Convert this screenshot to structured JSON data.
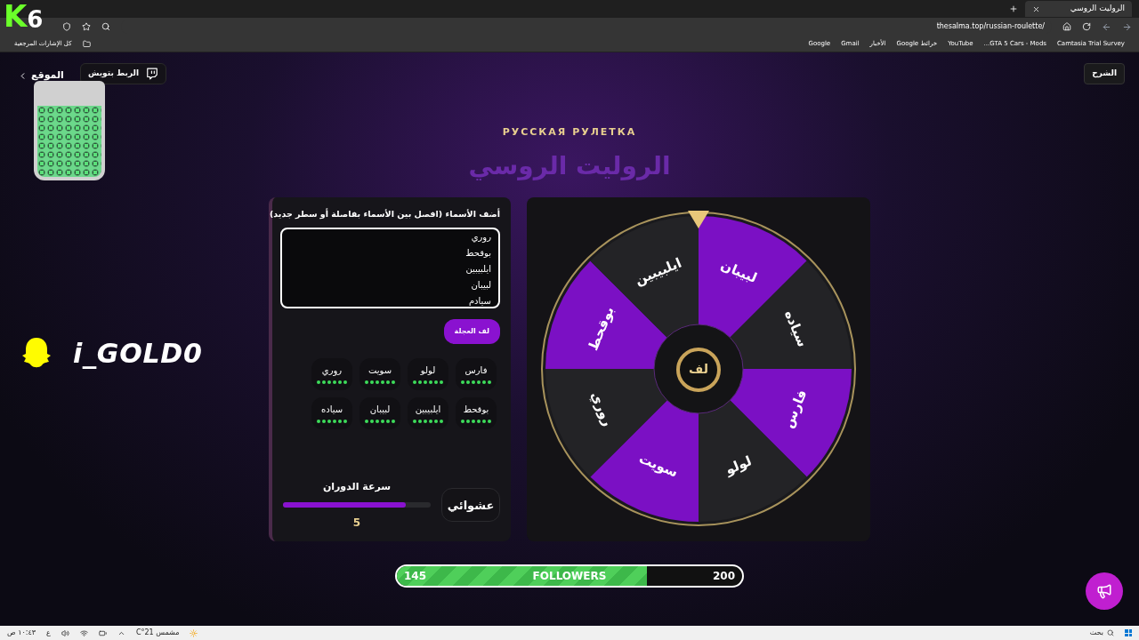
{
  "browser": {
    "tab_title": "الروليت الروسي",
    "url": "thesalma.top/russian-roulette/",
    "bookmarks": [
      "Camtasia Trial Survey",
      "GTA 5 Cars - Mods...",
      "YouTube",
      "خرائط Google",
      "الأخبار",
      "Gmail",
      "Google"
    ],
    "all_bookmarks": "كل الإشارات المرجعية"
  },
  "overlay": {
    "logo_letter": "K",
    "logo_number": "6",
    "snapchat_user": "i_GOLD0"
  },
  "header": {
    "back_link": "الموقع",
    "twitch_button": "الربط بتويش",
    "help_button": "الشرح"
  },
  "subtitle": "РУССКАЯ РУЛЕТКА",
  "title": "الروليت الروسي",
  "names_panel": {
    "label": "أضف الأسماء (افصل بين الأسماء بفاصلة أو سطر جديد)",
    "value": "روري\nبوقحط\nايلبيبين\nلبيبان\nسيادم",
    "spin_button": "لف العجلة",
    "chips": [
      "فارس",
      "لولو",
      "سويت",
      "روري",
      "بوقحط",
      "ايلبيبين",
      "لبيبان",
      "سياده"
    ],
    "speed_label": "سرعة الدوران",
    "speed": {
      "level": 0.83,
      "reading": "5"
    },
    "random_button": "عشوائي"
  },
  "wheel": {
    "segments": [
      "لبيبان",
      "سياده",
      "فارس",
      "لولو",
      "سويت",
      "روري",
      "بوقحط",
      "ايلبيبين"
    ],
    "center_button": "لف"
  },
  "followers": {
    "current": "145",
    "label": "FOLLOWERS",
    "goal": "200",
    "level": 0.725
  },
  "taskbar": {
    "search_placeholder": "بحث",
    "weather": "مشمس 21°C",
    "time": "١٠:٤٣ ص",
    "language": "ع"
  }
}
